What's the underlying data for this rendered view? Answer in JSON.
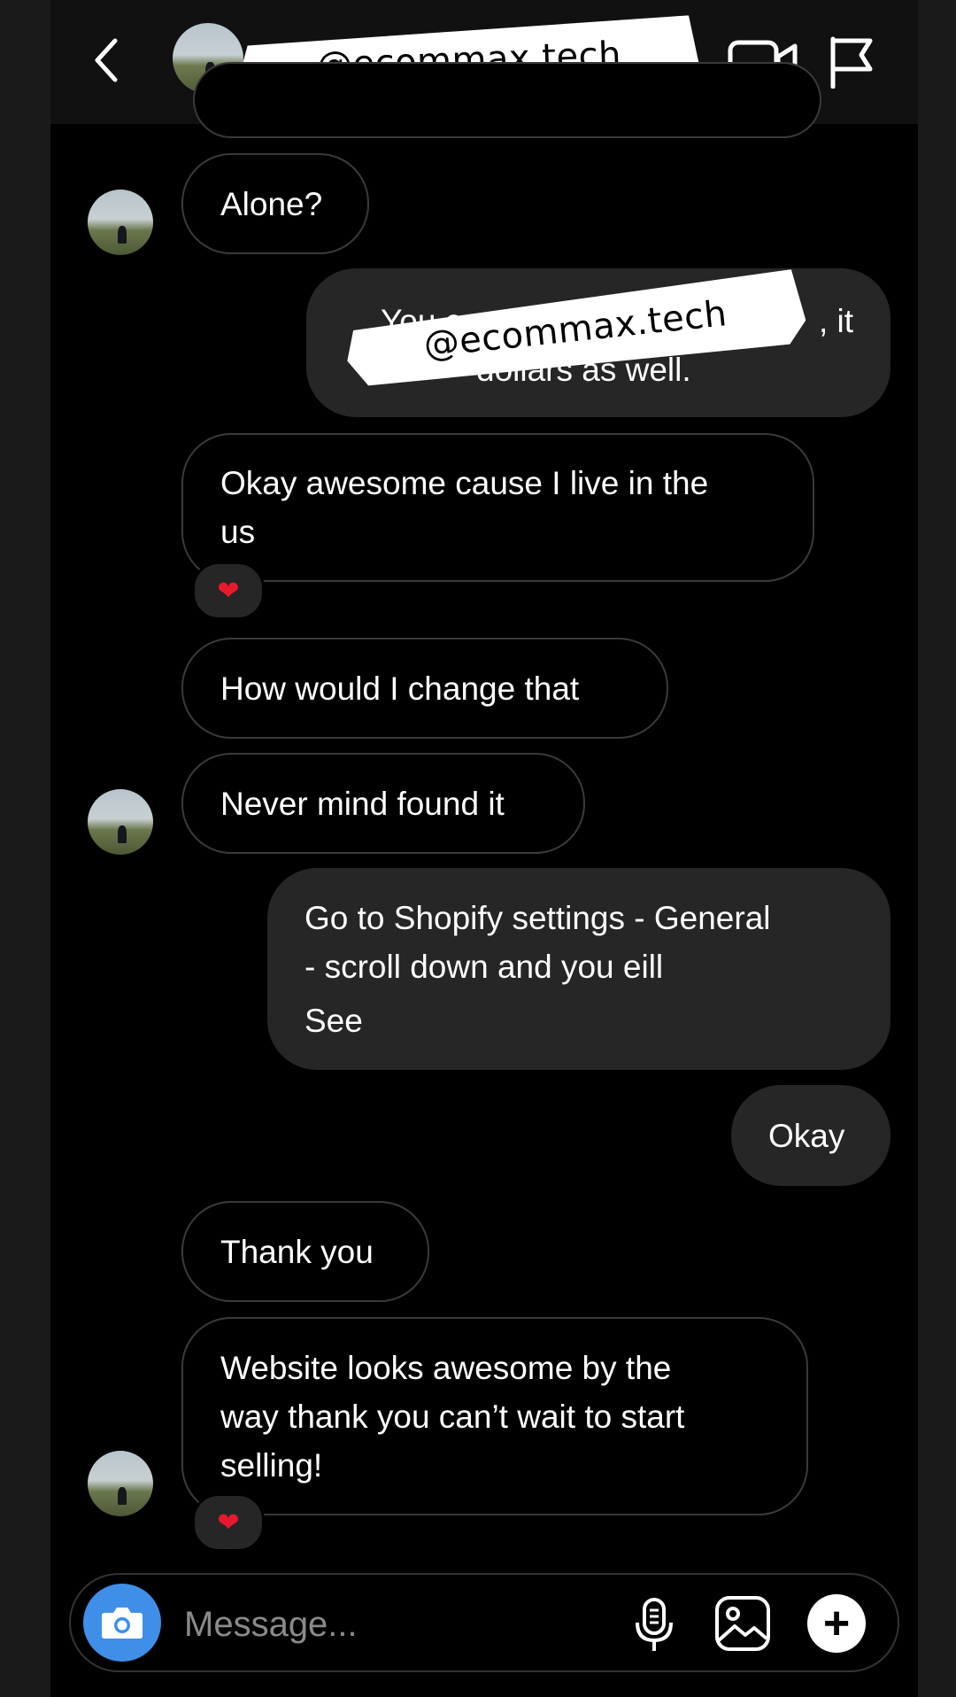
{
  "header": {
    "watermark": "@ecommax.tech"
  },
  "messages": {
    "m1": "Alone?",
    "m2_line1": "You can",
    "m2_line1_end": ", it",
    "m2_line2": "dollars as well.",
    "m2_watermark": "@ecommax.tech",
    "m3_line1": "Okay awesome cause I live in the",
    "m3_line2": "us",
    "m3_reaction": "❤",
    "m4": "How would I change that",
    "m5": "Never mind found it",
    "m6_line1": "Go to Shopify settings - General",
    "m6_line2": "- scroll down and you eill",
    "m6_line3": "See",
    "m7": "Okay",
    "m8": "Thank you",
    "m9_line1": "Website looks awesome by the",
    "m9_line2": "way thank you can’t wait to start",
    "m9_line3": "selling!",
    "m9_reaction": "❤"
  },
  "composer": {
    "placeholder": "Message..."
  },
  "icons": {
    "back": "chevron-left-icon",
    "video": "video-call-icon",
    "flag": "flag-icon",
    "camera": "camera-icon",
    "mic": "microphone-icon",
    "gallery": "gallery-icon",
    "plus": "plus-icon"
  },
  "colors": {
    "background": "#000000",
    "outgoing_bubble": "#262626",
    "incoming_border": "#3a3a3a",
    "camera_button": "#3f8fe8",
    "reaction": "#e8192c"
  }
}
